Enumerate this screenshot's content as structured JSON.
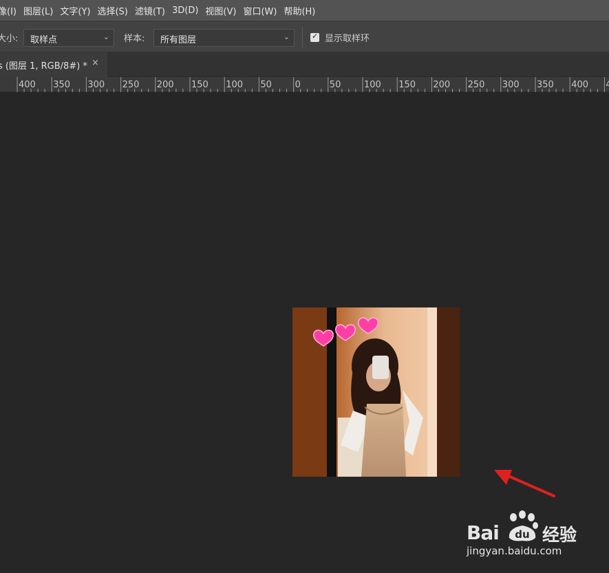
{
  "menubar": {
    "items": [
      "像(I)",
      "图层(L)",
      "文字(Y)",
      "选择(S)",
      "滤镜(T)",
      "3D(D)",
      "视图(V)",
      "窗口(W)",
      "帮助(H)"
    ]
  },
  "options": {
    "size_label": "大小:",
    "size_value": "取样点",
    "sample_label": "样本:",
    "sample_value": "所有图层",
    "show_ring_label": "显示取样环",
    "show_ring_checked": true
  },
  "tab": {
    "title": "s (图层 1, RGB/8#) *",
    "close": "×"
  },
  "ruler": {
    "labels": [
      "400",
      "350",
      "300",
      "250",
      "200",
      "150",
      "100",
      "50",
      "0",
      "50",
      "100",
      "150",
      "200",
      "250",
      "300",
      "350",
      "400",
      "4"
    ]
  },
  "watermark": {
    "brand": "Bai",
    "brand_suffix": "经验",
    "url": "jingyan.baidu.com"
  },
  "colors": {
    "menubar_bg": "#535353",
    "options_bg": "#424242",
    "canvas_bg": "#262626",
    "annotation_arrow": "#e02020"
  },
  "icons": [
    "chevron-down-icon",
    "checkbox-checked-icon",
    "close-icon",
    "paw-icon",
    "red-arrow-annotation"
  ]
}
